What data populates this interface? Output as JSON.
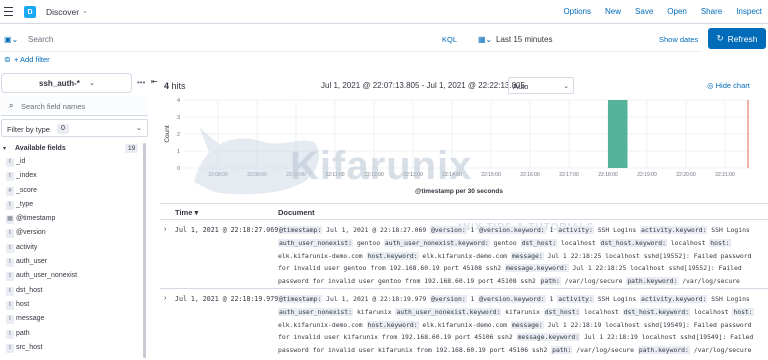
{
  "app": {
    "space_initial": "D",
    "title": "Discover",
    "top_links": [
      "Options",
      "New",
      "Save",
      "Open",
      "Share",
      "Inspect"
    ]
  },
  "query": {
    "search_placeholder": "Search",
    "language": "KQL",
    "time_range": "Last 15 minutes",
    "show_dates": "Show dates",
    "refresh": "Refresh"
  },
  "filters": {
    "add_filter": "+ Add filter"
  },
  "sidebar": {
    "index_pattern": "ssh_auth-*",
    "search_placeholder": "Search field names",
    "filter_by_type": "Filter by type",
    "filter_count": "0",
    "available_label": "Available fields",
    "available_count": "19",
    "fields": [
      {
        "type": "t",
        "name": "_id"
      },
      {
        "type": "t",
        "name": "_index"
      },
      {
        "type": "#",
        "name": "_score"
      },
      {
        "type": "t",
        "name": "_type"
      },
      {
        "type": "▦",
        "name": "@timestamp"
      },
      {
        "type": "t",
        "name": "@version"
      },
      {
        "type": "t",
        "name": "activity"
      },
      {
        "type": "t",
        "name": "auth_user"
      },
      {
        "type": "t",
        "name": "auth_user_nonexist"
      },
      {
        "type": "t",
        "name": "dst_host"
      },
      {
        "type": "t",
        "name": "host"
      },
      {
        "type": "t",
        "name": "message"
      },
      {
        "type": "t",
        "name": "path"
      },
      {
        "type": "t",
        "name": "src_host"
      }
    ]
  },
  "main": {
    "hits_count": "4",
    "hits_label": "hits",
    "time_range": "Jul 1, 2021 @ 22:07:13.805 - Jul 1, 2021 @ 22:22:13.805",
    "interval": "Auto",
    "hide_chart": "Hide chart"
  },
  "chart_data": {
    "type": "bar",
    "ylabel": "Count",
    "xlabel": "@timestamp per 30 seconds",
    "y_ticks": [
      "4",
      "3",
      "2",
      "1",
      "0"
    ],
    "ylim": [
      0,
      4
    ],
    "x_ticks": [
      "22:08:00",
      "22:09:00",
      "22:10:00",
      "22:11:00",
      "22:12:00",
      "22:13:00",
      "22:14:00",
      "22:15:00",
      "22:16:00",
      "22:17:00",
      "22:18:00",
      "22:19:00",
      "22:20:00",
      "22:21:00"
    ],
    "bars": [
      {
        "time": "22:18:00",
        "value": 4
      }
    ],
    "colors": {
      "bar": "#54b399",
      "now_line": "#e7664c"
    }
  },
  "table": {
    "col_time": "Time",
    "col_document": "Document",
    "rows": [
      {
        "time": "Jul 1, 2021 @ 22:18:27.069",
        "fields": [
          [
            "@timestamp:",
            "Jul 1, 2021 @ 22:18:27.069"
          ],
          [
            "@version:",
            "1"
          ],
          [
            "@version.keyword:",
            "1"
          ],
          [
            "activity:",
            "SSH Logins"
          ],
          [
            "activity.keyword:",
            "SSH Logins"
          ],
          [
            "auth_user_nonexist:",
            "gentoo"
          ],
          [
            "auth_user_nonexist.keyword:",
            "gentoo"
          ],
          [
            "dst_host:",
            "localhost"
          ],
          [
            "dst_host.keyword:",
            "localhost"
          ],
          [
            "host:",
            "elk.kifarunix-demo.com"
          ],
          [
            "host.keyword:",
            "elk.kifarunix-demo.com"
          ],
          [
            "message:",
            "Jul 1 22:18:25 localhost sshd[19552]: Failed password for invalid user gentoo from 192.168.60.19 port 45108 ssh2"
          ],
          [
            "message.keyword:",
            "Jul 1 22:18:25 localhost sshd[19552]: Failed password for invalid user gentoo from 192.168.60.19 port 45108 ssh2"
          ],
          [
            "path:",
            "/var/log/secure"
          ],
          [
            "path.keyword:",
            "/var/log/secure"
          ]
        ]
      },
      {
        "time": "Jul 1, 2021 @ 22:18:19.979",
        "fields": [
          [
            "@timestamp:",
            "Jul 1, 2021 @ 22:18:19.979"
          ],
          [
            "@version:",
            "1"
          ],
          [
            "@version.keyword:",
            "1"
          ],
          [
            "activity:",
            "SSH Logins"
          ],
          [
            "activity.keyword:",
            "SSH Logins"
          ],
          [
            "auth_user_nonexist:",
            "kifarunix"
          ],
          [
            "auth_user_nonexist.keyword:",
            "kifarunix"
          ],
          [
            "dst_host:",
            "localhost"
          ],
          [
            "dst_host.keyword:",
            "localhost"
          ],
          [
            "host:",
            "elk.kifarunix-demo.com"
          ],
          [
            "host.keyword:",
            "elk.kifarunix-demo.com"
          ],
          [
            "message:",
            "Jul 1 22:18:19 localhost sshd[19549]: Failed password for invalid user kifarunix from 192.168.60.19 port 45106 ssh2"
          ],
          [
            "message.keyword:",
            "Jul 1 22:18:19 localhost sshd[19549]: Failed password for invalid user kifarunix from 192.168.60.19 port 45106 ssh2"
          ],
          [
            "path:",
            "/var/log/secure"
          ],
          [
            "path.keyword:",
            "/var/log/secure"
          ]
        ]
      }
    ]
  },
  "watermark": {
    "brand": "Kifarunix",
    "tagline": "*NIX TIPS & TUTORIALS"
  }
}
